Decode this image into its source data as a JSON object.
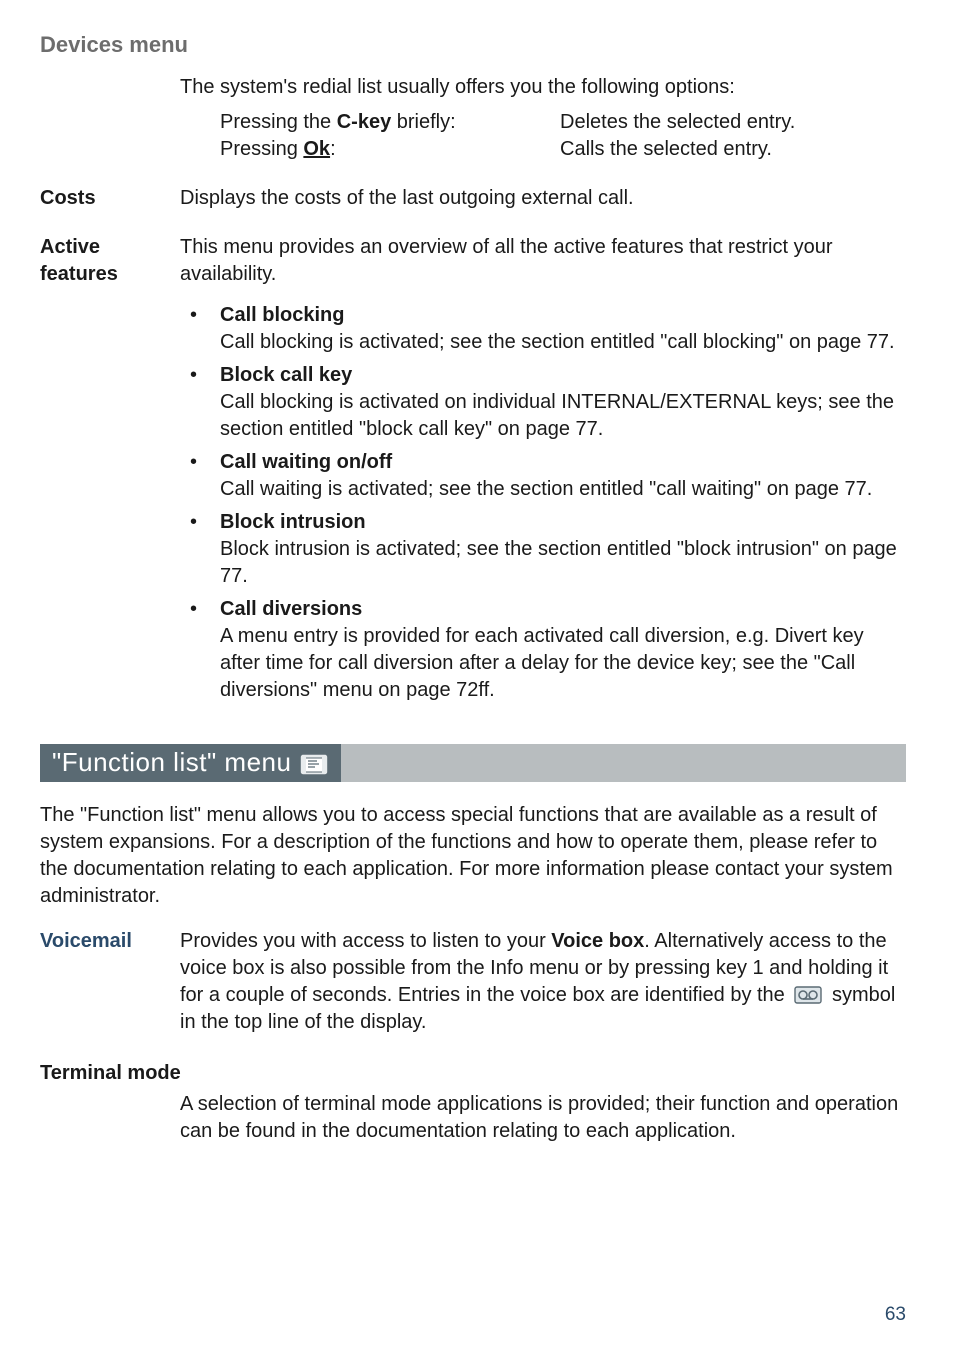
{
  "header": "Devices menu",
  "redial": {
    "intro": "The system's redial list usually offers you the following options:",
    "row1_l_pre": "Pressing the ",
    "row1_l_key": "C-key",
    "row1_l_post": " briefly:",
    "row1_r": "Deletes the selected entry.",
    "row2_l_pre": "Pressing ",
    "row2_l_key": "Ok",
    "row2_l_post": ":",
    "row2_r": "Calls the selected entry."
  },
  "costs": {
    "label": "Costs",
    "text": "Displays the costs of the last outgoing external call."
  },
  "active": {
    "label": "Active features",
    "text": "This menu provides an overview of all the active features that restrict your availability."
  },
  "features": {
    "f1_title": "Call blocking",
    "f1_text": "Call blocking is activated; see the section entitled \"call blocking\" on page 77.",
    "f2_title": "Block call key",
    "f2_text": "Call blocking is activated on individual INTERNAL/EXTERNAL keys; see the section entitled \"block call key\" on page 77.",
    "f3_title": "Call waiting on/off",
    "f3_text": "Call waiting is activated; see the section entitled \"call waiting\" on page 77.",
    "f4_title": "Block intrusion",
    "f4_text": "Block intrusion is activated; see the section entitled \"block intrusion\" on page 77.",
    "f5_title": "Call diversions",
    "f5_text": "A menu entry is provided for each activated call diversion, e.g. Divert key after time for call diversion after a delay for the device key; see the \"Call diversions\" menu on page 72ff."
  },
  "section_title": "\"Function list\" menu",
  "func_intro": "The \"Function list\" menu allows you to access special functions that are available as a result of system expansions. For a description of the functions and how to operate them, please refer to the documentation relating to each application. For more information please contact your system administrator.",
  "voicemail": {
    "label": "Voicemail",
    "pre1": "Provides you with access to listen to your ",
    "bold1": "Voice box",
    "post1": ". Alternatively access to the voice box is also possible from the Info menu or by pressing key 1 and holding it for a couple of seconds. Entries in the voice box are identified by the ",
    "post2": " symbol in the top line of the display."
  },
  "terminal": {
    "label": "Terminal mode",
    "text": "A selection of terminal mode applications is provided; their function and operation can be found in the documentation relating to each application."
  },
  "page_number": "63"
}
